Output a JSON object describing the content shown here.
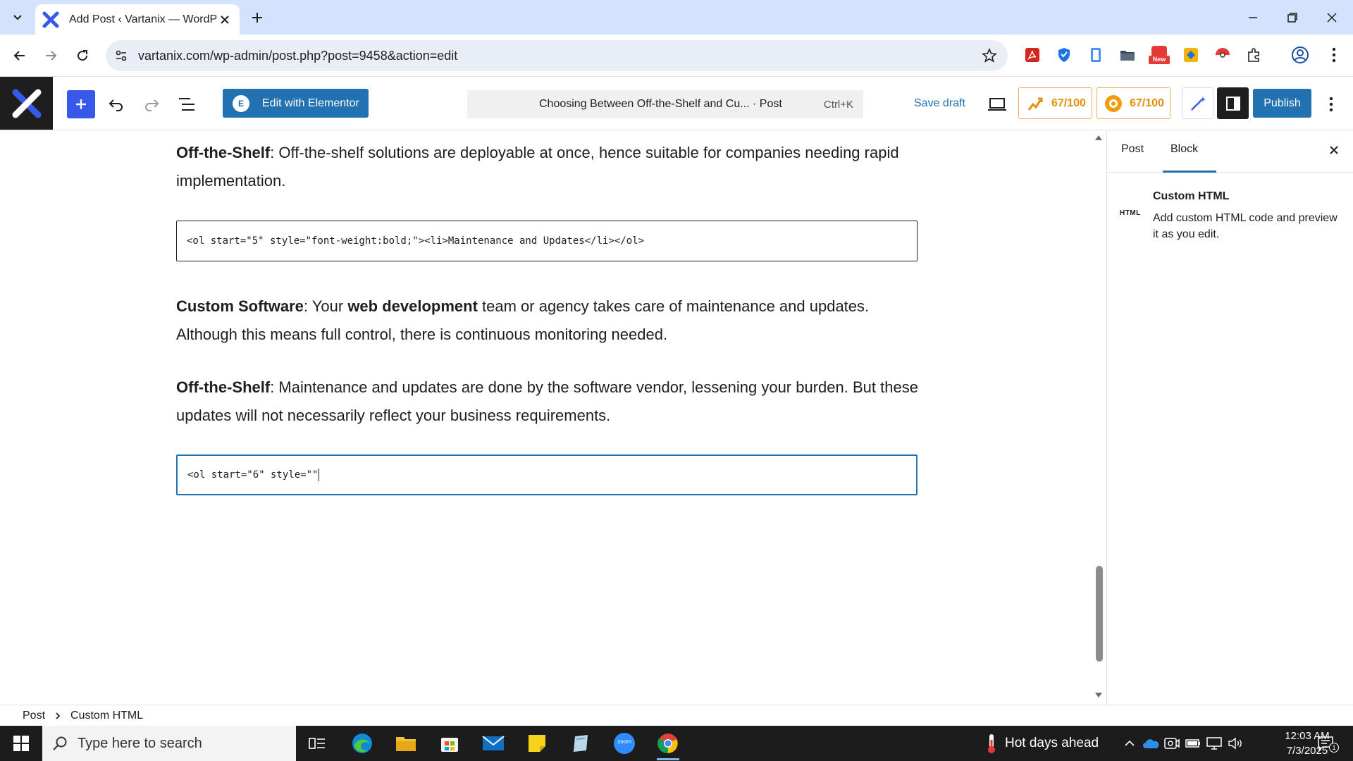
{
  "browser": {
    "tab_title": "Add Post ‹ Vartanix — WordPress",
    "url": "vartanix.com/wp-admin/post.php?post=9458&action=edit",
    "ext_badge_new": "New"
  },
  "editor": {
    "elementor_label": "Edit with Elementor",
    "elementor_icon_text": "E",
    "command_title": "Choosing Between Off-the-Shelf and Cu... · Post",
    "command_shortcut": "Ctrl+K",
    "save_draft": "Save draft",
    "seo_score_1": "67/100",
    "seo_score_2": "67/100",
    "publish": "Publish"
  },
  "content": {
    "p1_bold": "Off-the-Shelf",
    "p1_text": ": Off-the-shelf solutions are deployable at once, hence suitable for companies needing rapid implementation.",
    "html_block_1": "<ol start=\"5\" style=\"font-weight:bold;\"><li>Maintenance and Updates</li></ol>",
    "p2_bold1": "Custom Software",
    "p2_text1": ": Your ",
    "p2_bold2": "web development",
    "p2_text2": " team or agency takes care of maintenance and updates. Although this means full control, there is continuous monitoring needed.",
    "p3_bold": "Off-the-Shelf",
    "p3_text": ": Maintenance and updates are done by the software vendor, lessening your burden. But these updates will not necessarily reflect your business requirements.",
    "html_block_2": "<ol start=\"6\" style=\"\""
  },
  "sidebar": {
    "tab_post": "Post",
    "tab_block": "Block",
    "block_icon_label": "HTML",
    "block_title": "Custom HTML",
    "block_desc": "Add custom HTML code and preview it as you edit."
  },
  "breadcrumb": {
    "root": "Post",
    "current": "Custom HTML"
  },
  "taskbar": {
    "search_placeholder": "Type here to search",
    "zoom_label": "zoom",
    "weather": "Hot days ahead",
    "time": "12:03 AM",
    "date": "7/3/2025",
    "notif_count": "1"
  },
  "colors": {
    "wp_blue": "#2271b1",
    "inserter_blue": "#3858e9",
    "seo_orange": "#e58e0a"
  }
}
